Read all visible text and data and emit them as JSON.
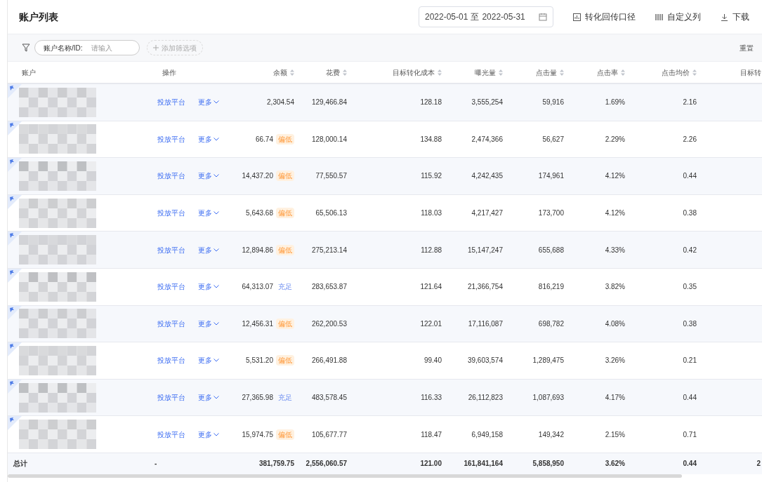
{
  "title": "账户列表",
  "date_range": {
    "start": "2022-05-01",
    "separator": "至",
    "end": "2022-05-31"
  },
  "toolbar": [
    "转化回传口径",
    "自定义列",
    "下载"
  ],
  "filter": {
    "label": "账户名称/ID:",
    "placeholder": "请输入",
    "add": "添加筛选项",
    "reset": "重置"
  },
  "columns": [
    {
      "label": "账户",
      "sortable": false
    },
    {
      "label": "操作",
      "sortable": false
    },
    {
      "label": "余额",
      "sortable": true
    },
    {
      "label": "花费",
      "sortable": true
    },
    {
      "label": "目标转化成本",
      "sortable": true
    },
    {
      "label": "曝光量",
      "sortable": true
    },
    {
      "label": "点击量",
      "sortable": true
    },
    {
      "label": "点击率",
      "sortable": true
    },
    {
      "label": "点击均价",
      "sortable": true
    },
    {
      "label": "目标转"
    }
  ],
  "rows": [
    {
      "actions": [
        "投放平台",
        "更多"
      ],
      "balance": "2,304.54",
      "cost": "129,466.84",
      "target_cost": "128.18",
      "impressions": "3,555,254",
      "clicks": "59,916",
      "ctr": "1.69%",
      "cpc": "2.16"
    },
    {
      "actions": [
        "投放平台",
        "更多"
      ],
      "balance": "66.74",
      "status": {
        "kind": "low",
        "label": "偏低"
      },
      "cost": "128,000.14",
      "target_cost": "134.88",
      "impressions": "2,474,366",
      "clicks": "56,627",
      "ctr": "2.29%",
      "cpc": "2.26"
    },
    {
      "actions": [
        "投放平台",
        "更多"
      ],
      "balance": "14,437.20",
      "status": {
        "kind": "low",
        "label": "偏低"
      },
      "cost": "77,550.57",
      "target_cost": "115.92",
      "impressions": "4,242,435",
      "clicks": "174,961",
      "ctr": "4.12%",
      "cpc": "0.44"
    },
    {
      "actions": [
        "投放平台",
        "更多"
      ],
      "balance": "5,643.68",
      "status": {
        "kind": "low",
        "label": "偏低"
      },
      "cost": "65,506.13",
      "target_cost": "118.03",
      "impressions": "4,217,427",
      "clicks": "173,700",
      "ctr": "4.12%",
      "cpc": "0.38"
    },
    {
      "actions": [
        "投放平台",
        "更多"
      ],
      "balance": "12,894.86",
      "status": {
        "kind": "low",
        "label": "偏低"
      },
      "cost": "275,213.14",
      "target_cost": "112.88",
      "impressions": "15,147,247",
      "clicks": "655,688",
      "ctr": "4.33%",
      "cpc": "0.42"
    },
    {
      "actions": [
        "投放平台",
        "更多"
      ],
      "balance": "64,313.07",
      "status": {
        "kind": "ok",
        "label": "充足"
      },
      "cost": "283,653.87",
      "target_cost": "121.64",
      "impressions": "21,366,754",
      "clicks": "816,219",
      "ctr": "3.82%",
      "cpc": "0.35"
    },
    {
      "actions": [
        "投放平台",
        "更多"
      ],
      "balance": "12,456.31",
      "status": {
        "kind": "low",
        "label": "偏低"
      },
      "cost": "262,200.53",
      "target_cost": "122.01",
      "impressions": "17,116,087",
      "clicks": "698,782",
      "ctr": "4.08%",
      "cpc": "0.38"
    },
    {
      "actions": [
        "投放平台",
        "更多"
      ],
      "balance": "5,531.20",
      "status": {
        "kind": "low",
        "label": "偏低"
      },
      "cost": "266,491.88",
      "target_cost": "99.40",
      "impressions": "39,603,574",
      "clicks": "1,289,475",
      "ctr": "3.26%",
      "cpc": "0.21"
    },
    {
      "actions": [
        "投放平台",
        "更多"
      ],
      "balance": "27,365.98",
      "status": {
        "kind": "ok",
        "label": "充足"
      },
      "cost": "483,578.45",
      "target_cost": "116.33",
      "impressions": "26,112,823",
      "clicks": "1,087,693",
      "ctr": "4.17%",
      "cpc": "0.44"
    },
    {
      "actions": [
        "投放平台",
        "更多"
      ],
      "balance": "15,974.75",
      "status": {
        "kind": "low",
        "label": "偏低"
      },
      "cost": "105,677.77",
      "target_cost": "118.47",
      "impressions": "6,949,158",
      "clicks": "149,342",
      "ctr": "2.15%",
      "cpc": "0.71"
    }
  ],
  "total": {
    "label": "总计",
    "actions": "-",
    "balance": "381,759.75",
    "cost": "2,556,060.57",
    "target_cost": "121.00",
    "impressions": "161,841,164",
    "clicks": "5,858,950",
    "ctr": "3.62%",
    "cpc": "0.44",
    "column_10": "2"
  }
}
